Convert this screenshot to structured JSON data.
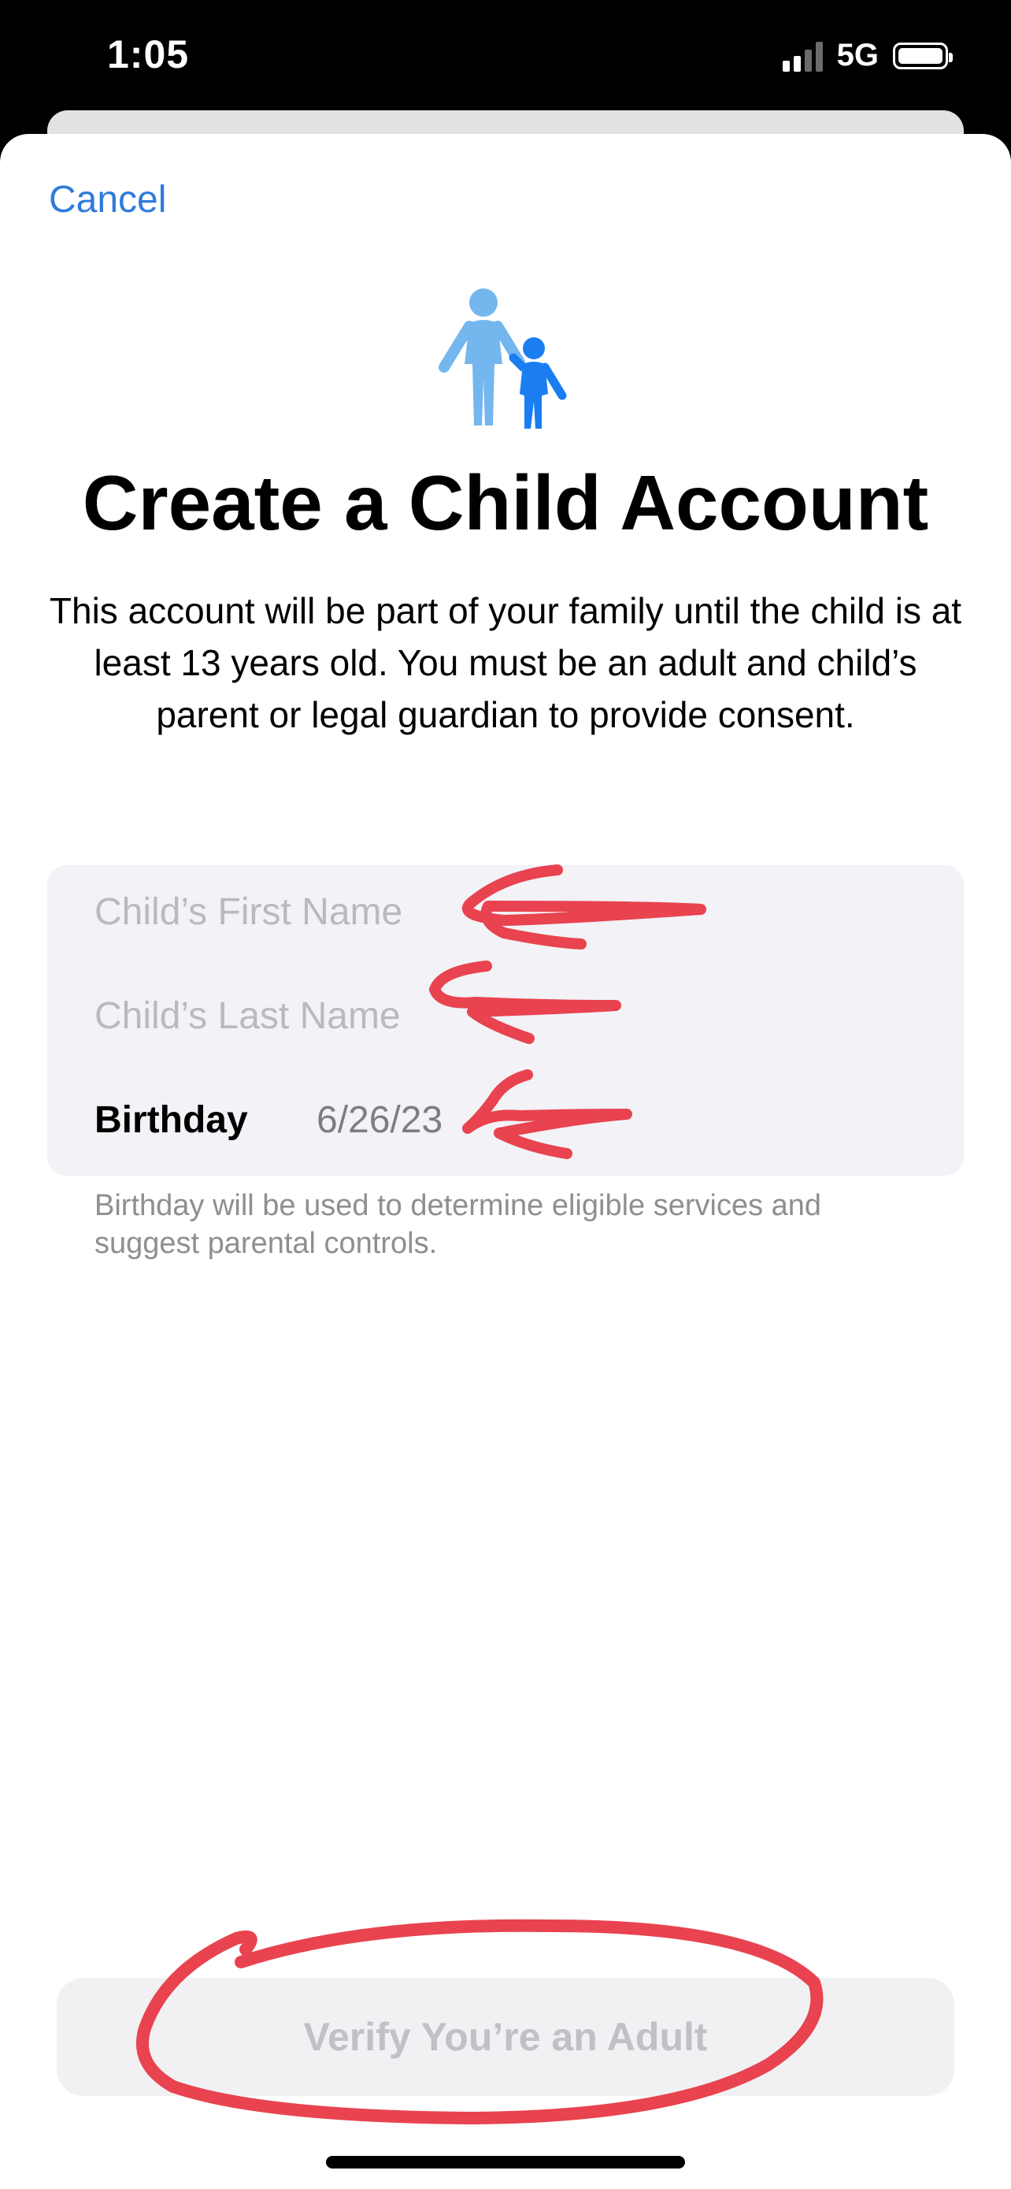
{
  "status_bar": {
    "time": "1:05",
    "network": "5G"
  },
  "nav": {
    "cancel_label": "Cancel"
  },
  "header": {
    "icon": "family-people-icon",
    "title": "Create a Child Account",
    "description": "This account will be part of your family until the child is at least 13 years old. You must be an adult and child’s parent or legal guardian to provide consent."
  },
  "form": {
    "first_name_placeholder": "Child’s First Name",
    "last_name_placeholder": "Child’s Last Name",
    "birthday_label": "Birthday",
    "birthday_value": "6/26/23",
    "footnote": "Birthday will be used to determine eligible services and suggest parental controls."
  },
  "actions": {
    "verify_label": "Verify You’re an Adult"
  },
  "colors": {
    "accent": "#2f7bdc",
    "annotation": "#e8434f",
    "icon_adult": "#74b6ee",
    "icon_child": "#1a7ef2"
  }
}
